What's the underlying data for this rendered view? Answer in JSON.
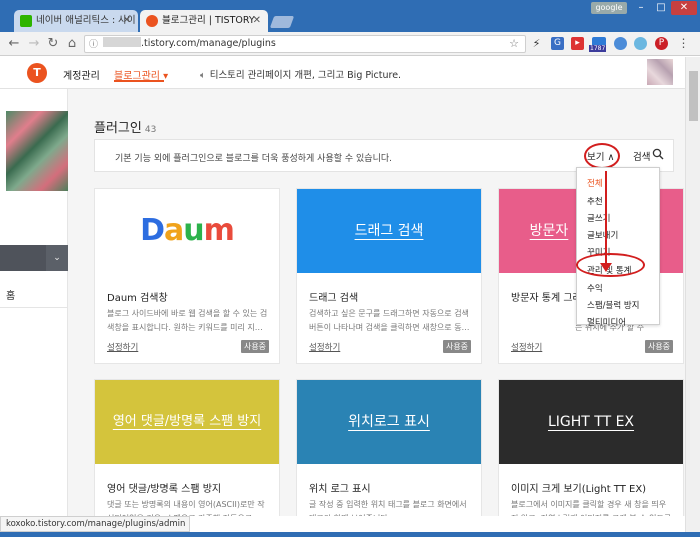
{
  "browser": {
    "tabs": [
      {
        "title": "네이버 애널리틱스 : 사이"
      },
      {
        "title": "블로그관리 | TISTORY"
      }
    ],
    "user_chip": "google",
    "window_controls": {
      "minimize": "–",
      "maximize": "□",
      "close": "✕"
    },
    "url": {
      "masked_prefix": "",
      "text": ".tistory.com/manage/plugins"
    },
    "extension_badge": "1787",
    "status_url": "koxoko.tistory.com/manage/plugins/admin"
  },
  "header": {
    "logo": "T",
    "account": "계정관리",
    "blog_manage": "블로그관리 ▾",
    "notice": "티스토리 관리페이지 개편, 그리고 Big Picture."
  },
  "sidebar": {
    "home_label": "홈",
    "select_chevron": "⌄"
  },
  "content": {
    "title": "플러그인",
    "count": "43",
    "description": "기본 기능 외에 플러그인으로 블로그를 더욱 풍성하게 사용할 수 있습니다.",
    "view_label": "보기 ∧",
    "search_label": "검색"
  },
  "dropdown": {
    "items": [
      "전체",
      "추천",
      "글쓰기",
      "글보내기",
      "꾸미기",
      "관리 및 통계",
      "수익",
      "스팸/블럭 방지",
      "멀티미디어"
    ],
    "active_color": "#eb531f"
  },
  "cards": [
    {
      "banner_text": "Daum",
      "title": "Daum 검색창",
      "desc": "블로그 사이드바에 바로 웹 검색을 할 수 있는 검색창을 표시합니다. 원하는 키워드를 미리 지…",
      "link": "설정하기",
      "badge": "사용중",
      "color": "#ffffff"
    },
    {
      "banner_text": "드래그 검색",
      "title": "드래그 검색",
      "desc": "검색하고 싶은 문구를 드래그하면 자동으로 검색 버튼이 나타나며 검색을 클릭하면 새창으로 동…",
      "link": "설정하기",
      "badge": "사용중",
      "color": "#1f8ee8"
    },
    {
      "banner_text": "방문자",
      "title": "방문자 통계 그래프",
      "desc": "는 위치에 추가 할 수",
      "link": "설정하기",
      "badge": "사용중",
      "color": "#e85d8a"
    },
    {
      "banner_text": "영어 댓글/방명록 스팸 방지",
      "title": "영어 댓글/방명록 스팸 방지",
      "desc": "댓글 또는 방명록의 내용이 영어(ASCII)로만 작성되어있을 경우, 스팸으로 간주해 자동으로 차…",
      "color": "#d4c43c"
    },
    {
      "banner_text": "위치로그 표시",
      "title": "위치 로그 표시",
      "desc": "글 작성 중 입력한 위치 태그를 블로그 화면에서 태그와 함께 보여줍니다.",
      "color": "#2a83b4"
    },
    {
      "banner_text": "LIGHT TT EX",
      "title": "이미지 크게 보기(Light TT EX)",
      "desc": "블로그에서 이미지를 클릭할 경우 새 창을 띄우지 않고, 자연스럽게 이미지를 크게 볼 수 있도록 …",
      "color": "#2b2b2b"
    }
  ]
}
